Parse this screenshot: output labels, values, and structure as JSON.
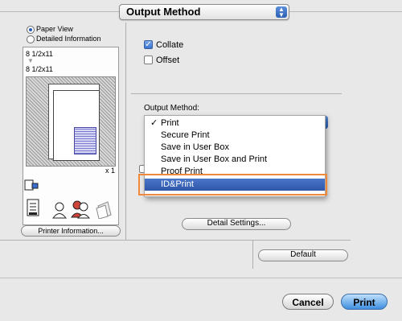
{
  "header": {
    "popup_label": "Output Method"
  },
  "left_panel": {
    "view_options": [
      {
        "label": "Paper View",
        "selected": true
      },
      {
        "label": "Detailed Information",
        "selected": false
      }
    ],
    "paper_size_source": "8 1/2x11",
    "paper_size_output": "8 1/2x11",
    "copies": "x 1",
    "printer_info_button": "Printer Information..."
  },
  "right_panel": {
    "collate": {
      "label": "Collate",
      "checked": true
    },
    "offset": {
      "label": "Offset",
      "checked": false
    },
    "output_method_label": "Output Method:",
    "menu": {
      "items": [
        {
          "label": "Print",
          "checked": true
        },
        {
          "label": "Secure Print",
          "checked": false
        },
        {
          "label": "Save in User Box",
          "checked": false
        },
        {
          "label": "Save in User Box and Print",
          "checked": false
        },
        {
          "label": "Proof Print",
          "checked": false
        },
        {
          "label": "ID&Print",
          "checked": false
        }
      ],
      "highlighted_index": 5
    },
    "checkmark_glyph": "✓",
    "detail_settings_button": "Detail Settings...",
    "default_button": "Default"
  },
  "footer": {
    "cancel_button": "Cancel",
    "print_button": "Print"
  },
  "colors": {
    "highlight": "#2f56a8",
    "callout": "#f08a3a"
  }
}
